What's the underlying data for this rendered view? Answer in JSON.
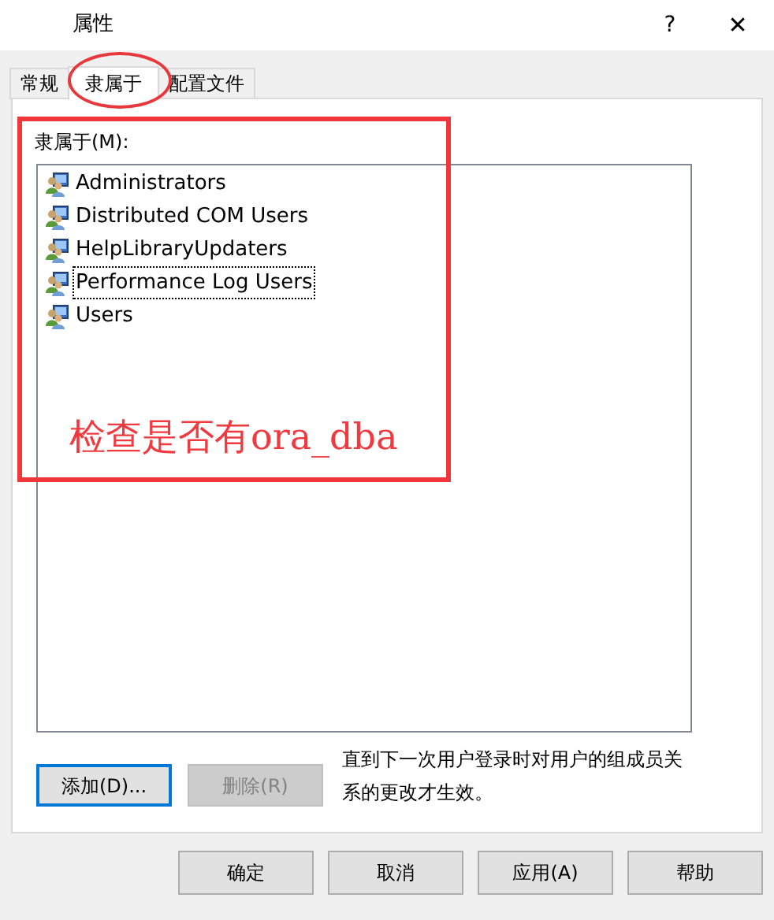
{
  "window": {
    "title": "属性",
    "help_button": "?",
    "close_button": "✕"
  },
  "tabs": [
    {
      "label": "常规",
      "selected": false
    },
    {
      "label": "隶属于",
      "selected": true
    },
    {
      "label": "配置文件",
      "selected": false
    }
  ],
  "member_of": {
    "label": "隶属于(M):",
    "groups": [
      {
        "name": "Administrators",
        "focused": false
      },
      {
        "name": "Distributed COM Users",
        "focused": false
      },
      {
        "name": "HelpLibraryUpdaters",
        "focused": false
      },
      {
        "name": "Performance Log Users",
        "focused": true
      },
      {
        "name": "Users",
        "focused": false
      }
    ]
  },
  "actions": [
    {
      "label": "添加(D)...",
      "disabled": false,
      "default": true
    },
    {
      "label": "删除(R)",
      "disabled": true,
      "default": false
    }
  ],
  "note": "直到下一次用户登录时对用户的组成员关系的更改才生效。",
  "buttons": [
    "确定",
    "取消",
    "应用(A)",
    "帮助"
  ],
  "annotations": [
    {
      "kind": "circle"
    },
    {
      "kind": "box"
    },
    {
      "kind": "text",
      "text": "检查是否有ora_dba"
    }
  ]
}
